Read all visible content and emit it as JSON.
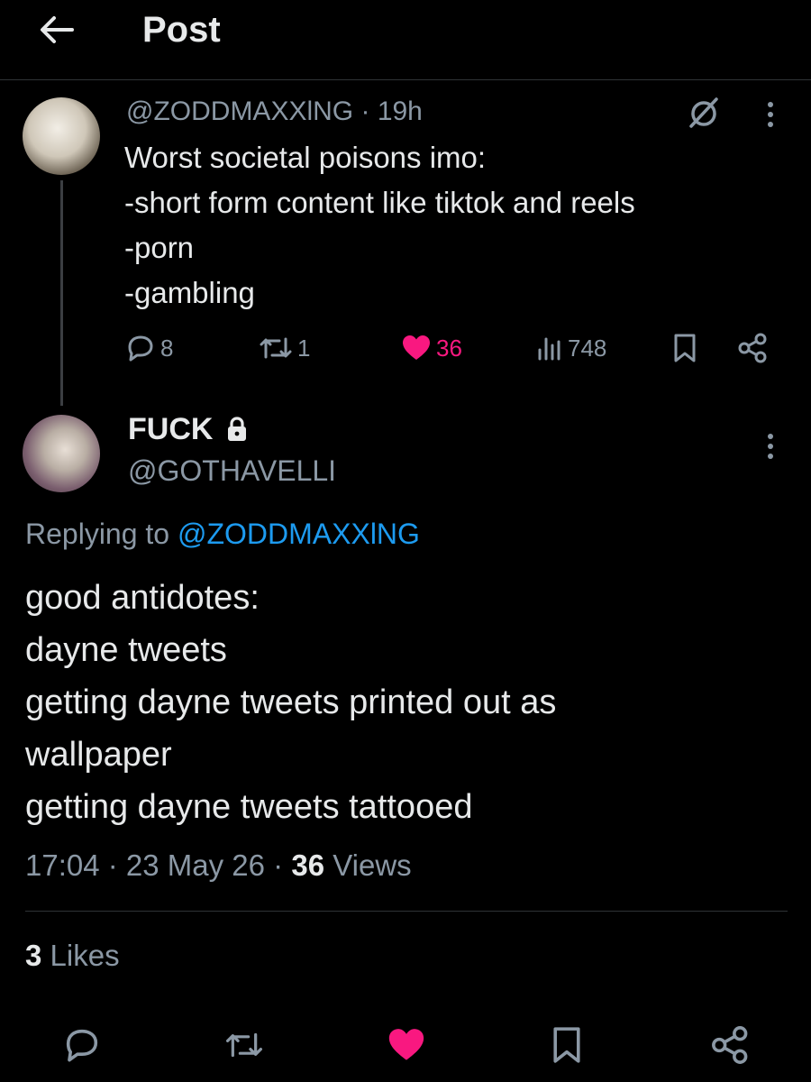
{
  "header": {
    "title": "Post"
  },
  "parent_post": {
    "handle": "@ZODDMAXXlNG",
    "time": "19h",
    "lines": [
      "Worst societal poisons imo:",
      "-short form content like tiktok and reels",
      "-porn",
      "-gambling"
    ],
    "stats": {
      "replies": "8",
      "reposts": "1",
      "likes": "36",
      "views": "748"
    },
    "like_color": "#f91880"
  },
  "main_post": {
    "display_name": "FUCK",
    "handle": "@GOTHAVELLI",
    "replying_prefix": "Replying to",
    "replying_to": "@ZODDMAXXlNG",
    "lines": [
      "good antidotes:",
      "dayne tweets",
      "getting dayne tweets printed out as",
      "wallpaper",
      "getting dayne tweets tattooed"
    ],
    "time": "17:04",
    "date": "23 May 26",
    "views_count": "36",
    "views_label": "Views",
    "likes_count": "3",
    "likes_label": "Likes"
  },
  "colors": {
    "background": "#000000",
    "text": "#e7e9ea",
    "muted": "#8b98a5",
    "link": "#1d9bf0",
    "like": "#f91880"
  },
  "icons": [
    "back-arrow-icon",
    "grok-icon",
    "more-icon",
    "reply-icon",
    "retweet-icon",
    "heart-icon",
    "views-icon",
    "bookmark-icon",
    "share-icon",
    "lock-icon"
  ]
}
